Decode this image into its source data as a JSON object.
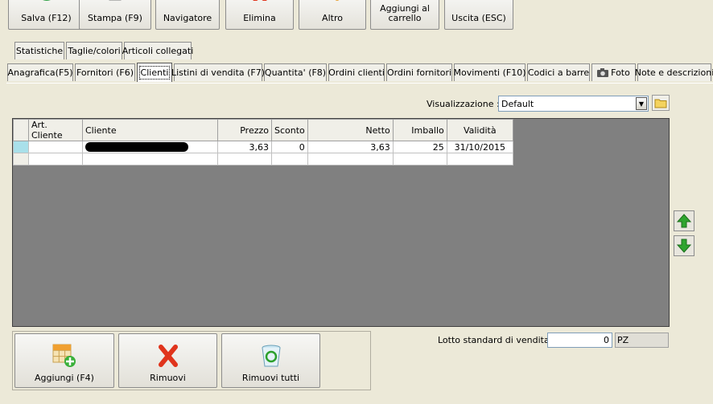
{
  "toolbar": {
    "buttons": [
      {
        "label": "Salva (F12)",
        "icon": "check-icon"
      },
      {
        "label": "Stampa (F9)",
        "icon": "printer-icon"
      },
      {
        "label": "Navigatore",
        "icon": "navigator-icon"
      },
      {
        "label": "Elimina",
        "icon": "delete-icon"
      },
      {
        "label": "Altro",
        "icon": "more-icon"
      },
      {
        "label": "Aggiungi al carrello",
        "icon": "cart-icon"
      },
      {
        "label": "Uscita (ESC)",
        "icon": "exit-icon"
      }
    ]
  },
  "tabs_top": [
    {
      "label": "Statistiche"
    },
    {
      "label": "Taglie/colori"
    },
    {
      "label": "Articoli collegati"
    }
  ],
  "tabs_main": [
    {
      "label": "Anagrafica(F5)"
    },
    {
      "label": "Fornitori (F6)"
    },
    {
      "label": "Clienti",
      "active": true
    },
    {
      "label": "Listini di vendita (F7)"
    },
    {
      "label": "Quantita' (F8)"
    },
    {
      "label": "Ordini clienti"
    },
    {
      "label": "Ordini fornitori"
    },
    {
      "label": "Movimenti (F10)"
    },
    {
      "label": "Codici a barre"
    },
    {
      "label": "Foto",
      "icon": "camera-icon"
    },
    {
      "label": "Note e descrizioni"
    }
  ],
  "view": {
    "label": "Visualizzazione :",
    "value": "Default"
  },
  "grid": {
    "columns": [
      "",
      "Art. Cliente",
      "Cliente",
      "Prezzo",
      "Sconto",
      "Netto",
      "Imballo",
      "Validità"
    ],
    "rows": [
      {
        "art_cliente": "",
        "cliente": "",
        "prezzo": "3,63",
        "sconto": "0",
        "netto": "3,63",
        "imballo": "25",
        "validita": "31/10/2015"
      }
    ]
  },
  "actions": [
    {
      "label": "Aggiungi (F4)",
      "icon": "add-grid-icon"
    },
    {
      "label": "Rimuovi",
      "icon": "remove-x-icon"
    },
    {
      "label": "Rimuovi tutti",
      "icon": "recycle-bin-icon"
    }
  ],
  "lotto": {
    "label": "Lotto standard di vendita :",
    "value": "0",
    "unit": "PZ"
  },
  "colors": {
    "grid_background": "#808080",
    "current_row_indicator": "#a9e0ea",
    "arrow_green": "#2fa52f"
  }
}
